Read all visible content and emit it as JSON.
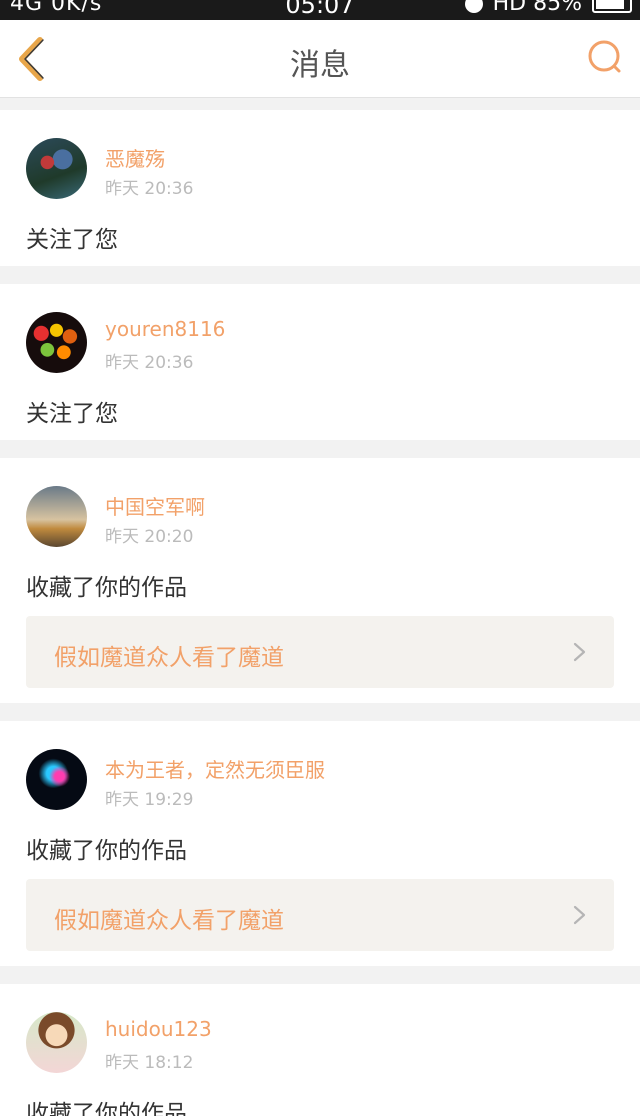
{
  "status_bar": {
    "left": "4G  0K/s",
    "time": "05:07",
    "right": "HD  85%"
  },
  "navbar": {
    "title": "消息"
  },
  "notifications": [
    {
      "username": "恶魔殇",
      "time": "昨天 20:36",
      "action": "关注了您"
    },
    {
      "username": "youren8116",
      "time": "昨天 20:36",
      "action": "关注了您"
    },
    {
      "username": "中国空军啊",
      "time": "昨天 20:20",
      "action": "收藏了你的作品",
      "work": "假如魔道众人看了魔道"
    },
    {
      "username": "本为王者，定然无须臣服",
      "time": "昨天 19:29",
      "action": "收藏了你的作品",
      "work": "假如魔道众人看了魔道"
    },
    {
      "username": "huidou123",
      "time": "昨天 18:12",
      "action": "收藏了你的作品"
    }
  ],
  "colors": {
    "accent": "#f2a169",
    "back_icon": "#e8a64a",
    "search_icon": "#f2a169",
    "time_text": "#bbbbbb",
    "page_background": "#f2f2f2"
  },
  "icons": {
    "back": "chevron-left-icon",
    "search": "search-icon",
    "link": "chevron-right-icon"
  }
}
